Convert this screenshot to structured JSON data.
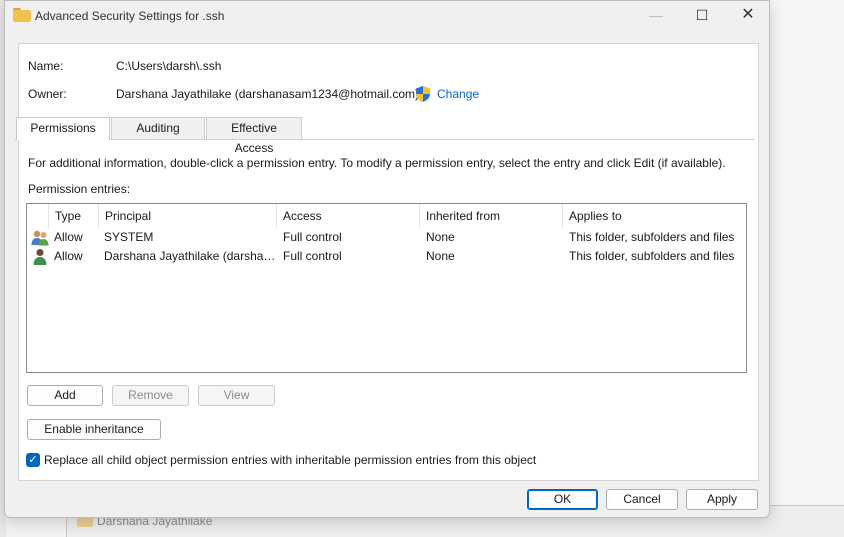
{
  "window": {
    "title": "Advanced Security Settings for .ssh",
    "minimize": "—",
    "maximize": "☐",
    "close": "✕"
  },
  "info": {
    "name_label": "Name:",
    "name_value": "C:\\Users\\darsh\\.ssh",
    "owner_label": "Owner:",
    "owner_value": "Darshana Jayathilake (darshanasam1234@hotmail.com)",
    "change_link": "Change"
  },
  "tabs": [
    {
      "label": "Permissions",
      "active": true
    },
    {
      "label": "Auditing",
      "active": false
    },
    {
      "label": "Effective Access",
      "active": false
    }
  ],
  "permissions": {
    "description": "For additional information, double-click a permission entry. To modify a permission entry, select the entry and click Edit (if available).",
    "entries_label": "Permission entries:",
    "columns": [
      "Type",
      "Principal",
      "Access",
      "Inherited from",
      "Applies to"
    ],
    "rows": [
      {
        "type": "Allow",
        "principal": "SYSTEM",
        "access": "Full control",
        "inherited_from": "None",
        "applies_to": "This folder, subfolders and files"
      },
      {
        "type": "Allow",
        "principal": "Darshana Jayathilake (darshan…",
        "access": "Full control",
        "inherited_from": "None",
        "applies_to": "This folder, subfolders and files"
      }
    ],
    "add_button": "Add",
    "remove_button": "Remove",
    "view_button": "View",
    "enable_inheritance_button": "Enable inheritance",
    "replace_checkbox_label": "Replace all child object permission entries with inheritable permission entries from this object",
    "replace_checked": true
  },
  "footer": {
    "ok": "OK",
    "cancel": "Cancel",
    "apply": "Apply"
  },
  "background": {
    "folder_label": "Darshana Jayathilake"
  },
  "colors": {
    "accent": "#0067c0",
    "link": "#0066cc"
  }
}
